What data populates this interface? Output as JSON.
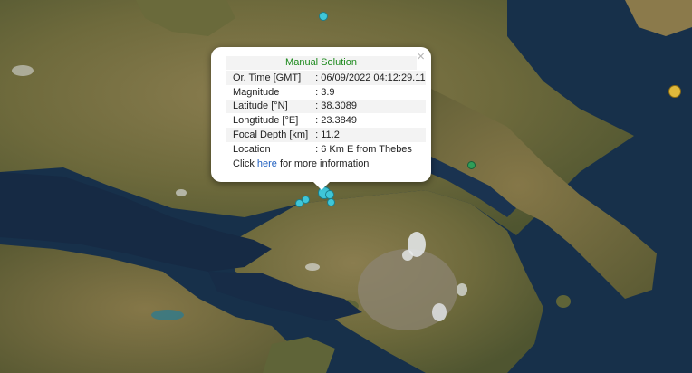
{
  "popup": {
    "title": "Manual Solution",
    "close_glyph": "×",
    "rows": [
      {
        "label": "Or. Time [GMT]",
        "value": ": 06/09/2022 04:12:29.11"
      },
      {
        "label": "Magnitude",
        "value": ": 3.9"
      },
      {
        "label": "Latitude [°N]",
        "value": ": 38.3089"
      },
      {
        "label": "Longtitude [°E]",
        "value": ": 23.3849"
      },
      {
        "label": "Focal Depth [km]",
        "value": ": 11.2"
      },
      {
        "label": "Location",
        "value": ": 6 Km E from Thebes"
      }
    ],
    "more_prefix": "Click",
    "more_link": "here",
    "more_suffix": "for more information"
  },
  "colors": {
    "quake_marker": "#3fc6d8",
    "green_marker": "#2f9e58",
    "yellow_marker": "#e0b93b",
    "popup_title": "#1d8a1d",
    "link": "#1f5fbf"
  }
}
